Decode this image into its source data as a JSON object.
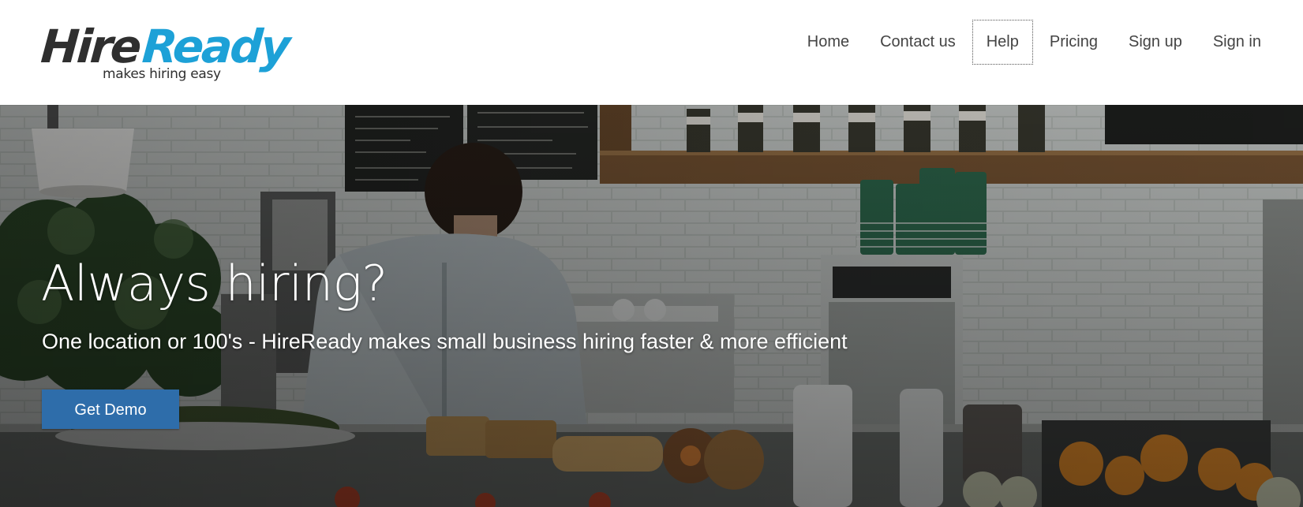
{
  "brand": {
    "name_part1": "Hire",
    "name_part2": "Ready",
    "tagline": "makes hiring easy",
    "primary_color": "#1da1d7",
    "dark_color": "#2f2f2f"
  },
  "nav": {
    "items": [
      {
        "label": "Home",
        "active": false
      },
      {
        "label": "Contact us",
        "active": false
      },
      {
        "label": "Help",
        "active": true
      },
      {
        "label": "Pricing",
        "active": false
      },
      {
        "label": "Sign up",
        "active": false
      },
      {
        "label": "Sign in",
        "active": false
      }
    ]
  },
  "hero": {
    "title": "Always hiring?",
    "subtitle": "One location or 100's - HireReady makes small business hiring faster & more efficient",
    "cta_label": "Get Demo",
    "cta_color": "#2e6daa"
  }
}
